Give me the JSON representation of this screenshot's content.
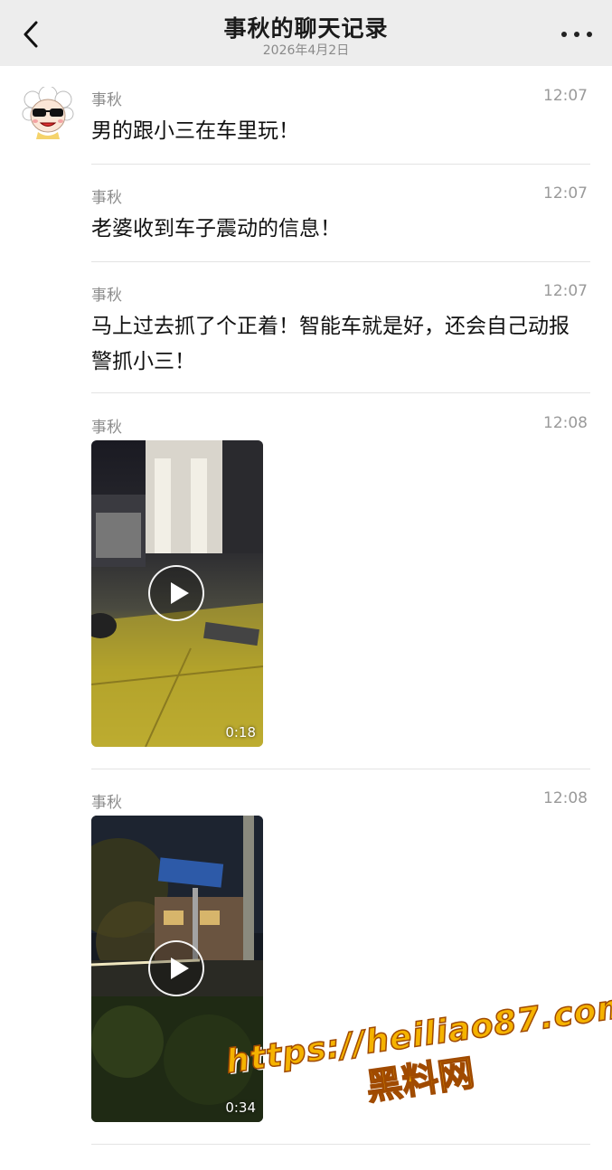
{
  "header": {
    "title": "事秋的聊天记录",
    "date": "2026年4月2日"
  },
  "messages": [
    {
      "sender": "事秋",
      "time": "12:07",
      "text": "男的跟小三在车里玩！"
    },
    {
      "sender": "事秋",
      "time": "12:07",
      "text": "老婆收到车子震动的信息！"
    },
    {
      "sender": "事秋",
      "time": "12:07",
      "text": "马上过去抓了个正着！智能车就是好，还会自己动报警抓小三！"
    },
    {
      "sender": "事秋",
      "time": "12:08",
      "video_duration": "0:18"
    },
    {
      "sender": "事秋",
      "time": "12:08",
      "video_duration": "0:34"
    }
  ],
  "watermark": {
    "url": "https://heiliao87.com",
    "name": "黑料网"
  },
  "colors": {
    "header_bg": "#ededed",
    "watermark_fill": "#f5b300"
  }
}
